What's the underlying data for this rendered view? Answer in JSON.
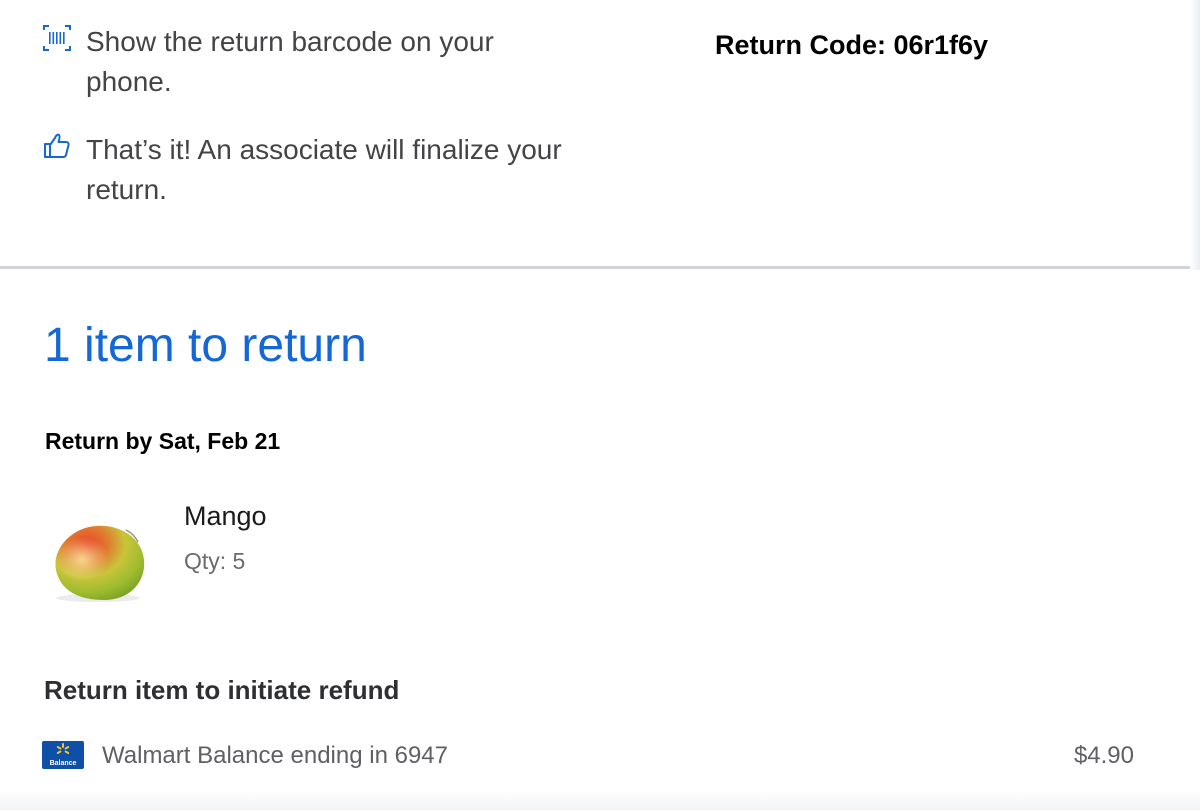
{
  "steps": [
    {
      "icon": "barcode-icon",
      "text": "Show the return barcode on your phone."
    },
    {
      "icon": "thumbs-up-icon",
      "text": "That’s it! An associate will finalize your return."
    }
  ],
  "return_code": {
    "text": "Return Code: 06r1f6y"
  },
  "items_section": {
    "title": "1 item to return",
    "return_by": "Return by Sat, Feb 21"
  },
  "product": {
    "name": "Mango",
    "qty": "Qty: 5",
    "image": "mango-image"
  },
  "refund": {
    "heading": "Return item to initiate refund",
    "card_icon": "walmart-balance-card-icon",
    "card_badge_text": "Balance",
    "method": "Walmart Balance ending in 6947",
    "amount": "$4.90"
  },
  "colors": {
    "accent_blue": "#1468d6",
    "walmart_blue": "#0e4fa8",
    "walmart_yellow": "#ffc220"
  }
}
